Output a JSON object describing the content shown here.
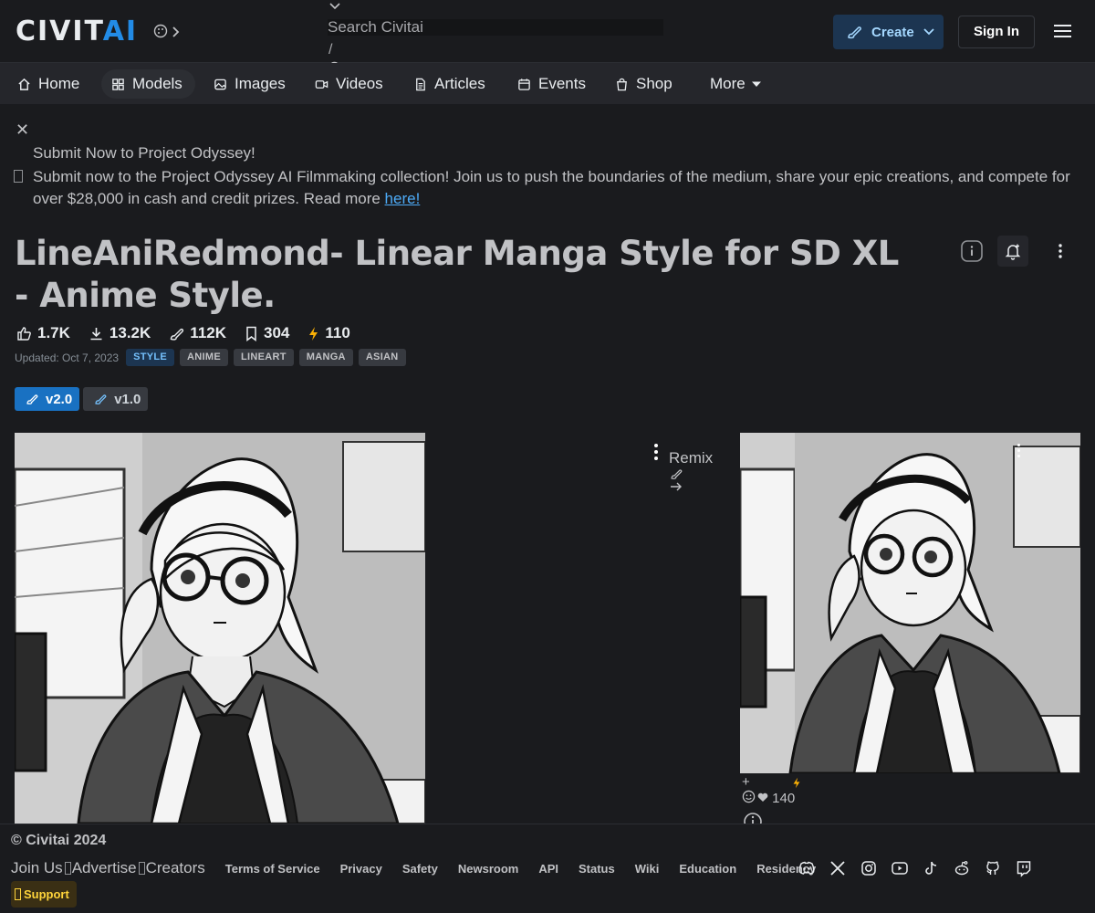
{
  "brand": {
    "part1": "CIVIT",
    "part2": "AI"
  },
  "search": {
    "placeholder": "Search Civitai",
    "shortcut": "/"
  },
  "header": {
    "create_label": "Create",
    "signin_label": "Sign In"
  },
  "nav": {
    "items": [
      {
        "label": "Home",
        "icon": "home-icon"
      },
      {
        "label": "Models",
        "icon": "grid-icon"
      },
      {
        "label": "Images",
        "icon": "photo-icon"
      },
      {
        "label": "Videos",
        "icon": "video-icon"
      },
      {
        "label": "Articles",
        "icon": "file-icon"
      },
      {
        "label": "Events",
        "icon": "calendar-icon"
      },
      {
        "label": "Shop",
        "icon": "bag-icon"
      },
      {
        "label": "More",
        "icon": "caret-down-icon"
      }
    ]
  },
  "banner": {
    "title": "Submit Now to Project Odyssey!",
    "text": "Submit now to the Project Odyssey AI Filmmaking collection! Join us to push the boundaries of the medium, share your epic creations, and compete for over $28,000 in cash and credit prizes. Read more ",
    "link": "here!"
  },
  "model": {
    "title": "LineAniRedmond- Linear Manga Style for SD XL - Anime Style.",
    "stats": {
      "likes": "1.7K",
      "downloads": "13.2K",
      "generations": "112K",
      "bookmarks": "304",
      "buzz": "110"
    },
    "updated": "Updated: Oct 7, 2023",
    "tags": [
      "STYLE",
      "ANIME",
      "LINEART",
      "MANGA",
      "ASIAN"
    ],
    "versions": [
      "v2.0",
      "v1.0"
    ]
  },
  "gallery": {
    "remix_label": "Remix",
    "reaction_count": "140"
  },
  "footer": {
    "copyright": "© Civitai 2024",
    "plain_links": [
      "Join Us",
      "Advertise",
      "Creators"
    ],
    "links": [
      "Terms of Service",
      "Privacy",
      "Safety",
      "Newsroom",
      "API",
      "Status",
      "Wiki",
      "Education",
      "Residency"
    ],
    "social_icons": [
      "discord-icon",
      "x-icon",
      "instagram-icon",
      "youtube-icon",
      "tiktok-icon",
      "reddit-icon",
      "github-icon",
      "twitch-icon"
    ],
    "support_label": "Support"
  },
  "colors": {
    "background": "#1a1b1e",
    "accent": "#228be6",
    "nav": "#25262b",
    "buzz": "#fab005"
  }
}
